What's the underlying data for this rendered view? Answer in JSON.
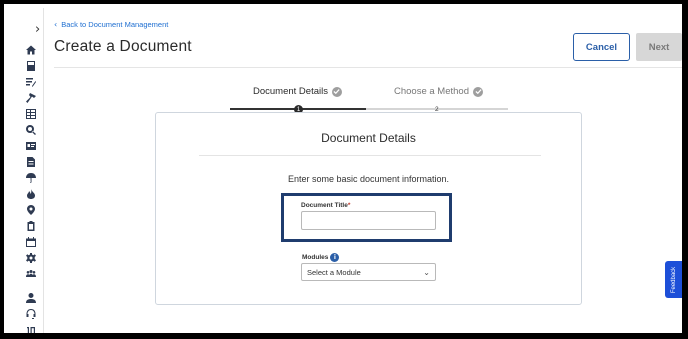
{
  "sidebar": {
    "toggle": "›",
    "icons": [
      "home-icon",
      "document-icon",
      "edit-document-icon",
      "hammer-icon",
      "grid-list-icon",
      "search-icon",
      "id-card-icon",
      "file-icon",
      "umbrella-icon",
      "fire-icon",
      "location-pin-icon",
      "clipboard-icon",
      "calendar-icon",
      "settings-icon",
      "team-icon",
      "user-icon",
      "headset-icon",
      "number-icon"
    ]
  },
  "header": {
    "back_link": "Back to Document Management",
    "title": "Create a Document",
    "cancel_label": "Cancel",
    "next_label": "Next"
  },
  "stepper": {
    "steps": [
      {
        "label": "Document Details",
        "number": "1"
      },
      {
        "label": "Choose a Method",
        "number": "2"
      }
    ]
  },
  "card": {
    "title": "Document Details",
    "intro": "Enter some basic document information.",
    "title_field": {
      "label": "Document Title",
      "required_mark": "*",
      "value": "",
      "placeholder": ""
    },
    "modules": {
      "label": "Modules",
      "info": "i",
      "selected": "Select a Module"
    }
  },
  "feedback": {
    "label": "Feedback"
  },
  "colors": {
    "accent": "#2b5fa8",
    "link": "#1f6fd1",
    "highlight": "#1f3c6e",
    "feedback": "#1d4fd8"
  }
}
